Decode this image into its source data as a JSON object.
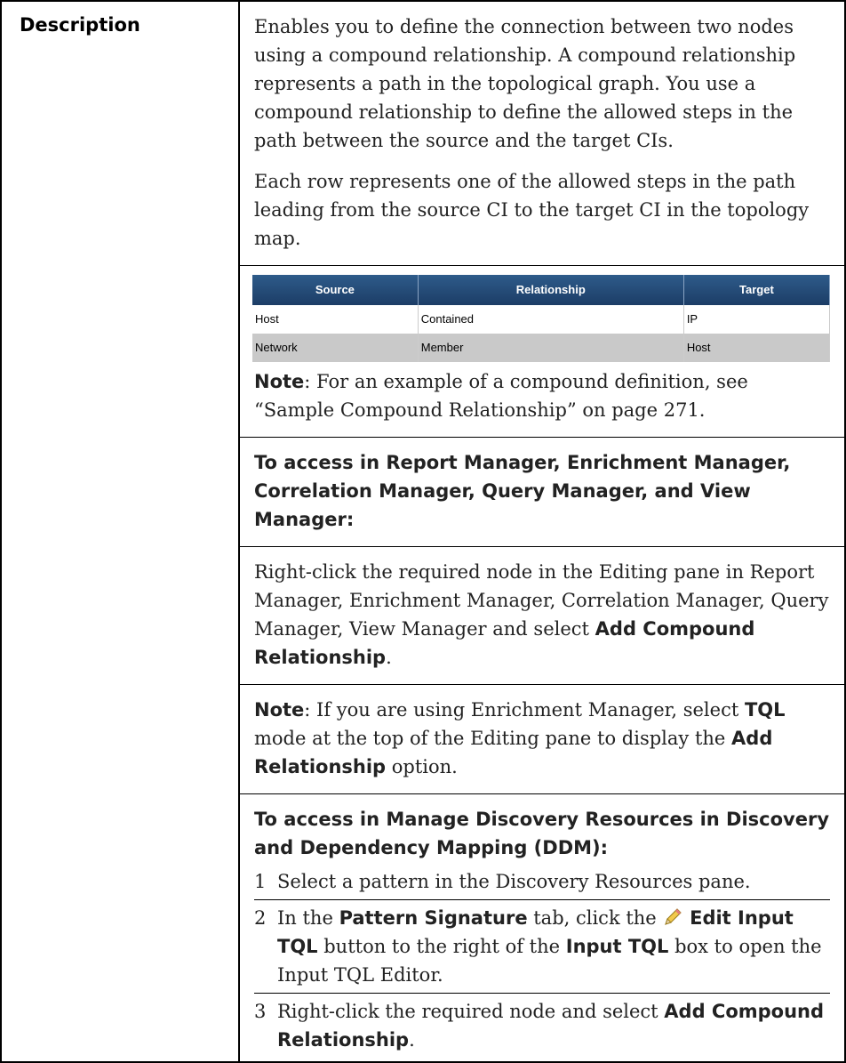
{
  "label": "Description",
  "intro": [
    "Enables you to define the connection between two nodes using a compound relationship. A compound relationship represents a path in the topological graph. You use a compound relationship to define the allowed steps in the path between the source and the target CIs.",
    "Each row represents one of the allowed steps in the path leading from the source CI to the target CI in the topology map."
  ],
  "embedded_table": {
    "headers": [
      "Source",
      "Relationship",
      "Target"
    ],
    "rows": [
      [
        "Host",
        "Contained",
        "IP"
      ],
      [
        "Network",
        "Member",
        "Host"
      ]
    ]
  },
  "note1": {
    "label": "Note",
    "text": ": For an example of a compound definition, see “Sample Compound Relationship” on page 271."
  },
  "access1_heading": "To access in Report Manager, Enrichment Manager, Correlation Manager, Query Manager, and View Manager:",
  "access1_text": {
    "pre": "Right-click the required node in the Editing pane in Report Manager, Enrichment Manager, Correlation Manager, Query Manager, View Manager and select ",
    "bold": "Add Compound Relationship",
    "post": "."
  },
  "note2": {
    "label": "Note",
    "t1": ": If you are using Enrichment Manager, select ",
    "b1": "TQL",
    "t2": " mode at the top of the Editing pane to display the ",
    "b2": "Add Relationship",
    "t3": " option."
  },
  "access2_heading": "To access in Manage Discovery Resources in Discovery and Dependency Mapping (DDM):",
  "steps": [
    {
      "num": "1",
      "text": "Select a pattern in the Discovery Resources pane."
    },
    {
      "num": "2",
      "t1": "In the ",
      "b1": "Pattern Signature",
      "t2": " tab, click the ",
      "b2": "Edit Input TQL",
      "t3": " button to the right of the ",
      "b3": "Input TQL",
      "t4": " box to open the Input TQL Editor."
    },
    {
      "num": "3",
      "t1": "Right-click the required node and select ",
      "b1": "Add Compound Relationship",
      "t2": "."
    }
  ],
  "icons": {
    "edit": "pencil-icon"
  }
}
